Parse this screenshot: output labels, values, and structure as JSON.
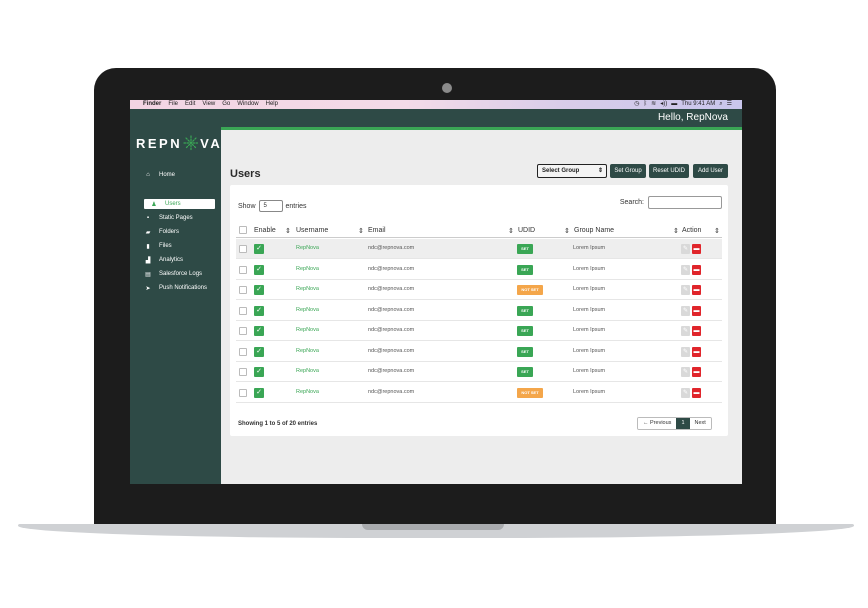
{
  "menubar": {
    "apple": "",
    "items": [
      "Finder",
      "File",
      "Edit",
      "View",
      "Go",
      "Window",
      "Help"
    ],
    "clock": "Thu 9:41 AM",
    "status_icons": [
      "clock-icon",
      "bluetooth-icon",
      "wifi-icon",
      "volume-icon",
      "battery-icon",
      "search-icon",
      "menu-icon"
    ]
  },
  "header": {
    "greeting": "Hello, RepNova"
  },
  "brand": {
    "logo_left": "REPN",
    "logo_right": "VA"
  },
  "sidebar": {
    "items": [
      {
        "label": "Home",
        "icon": "home-icon",
        "active": false
      },
      {
        "label": "Users",
        "icon": "user-icon",
        "active": true
      },
      {
        "label": "Static Pages",
        "icon": "page-icon",
        "active": false
      },
      {
        "label": "Folders",
        "icon": "folder-icon",
        "active": false
      },
      {
        "label": "Files",
        "icon": "file-icon",
        "active": false
      },
      {
        "label": "Analytics",
        "icon": "chart-icon",
        "active": false
      },
      {
        "label": "Salesforce Logs",
        "icon": "log-icon",
        "active": false
      },
      {
        "label": "Push Notifications",
        "icon": "send-icon",
        "active": false
      }
    ]
  },
  "page": {
    "title": "Users",
    "select_group": "Select Group",
    "buttons": {
      "set_group": "Set Group",
      "reset_udid": "Reset UDID",
      "add_user": "Add User"
    }
  },
  "table": {
    "show_label": "Show",
    "show_value": "5",
    "entries_label": "entries",
    "search_label": "Search:",
    "columns": [
      "Enable",
      "Username",
      "Email",
      "UDID",
      "Group Name",
      "Action"
    ],
    "rows": [
      {
        "username": "RepNova",
        "email": "ndc@repnova.com",
        "udid": "SET",
        "group": "Lorem Ipsum"
      },
      {
        "username": "RepNova",
        "email": "ndc@repnova.com",
        "udid": "SET",
        "group": "Lorem Ipsum"
      },
      {
        "username": "RepNova",
        "email": "ndc@repnova.com",
        "udid": "NOT SET",
        "group": "Lorem Ipsum"
      },
      {
        "username": "RepNova",
        "email": "ndc@repnova.com",
        "udid": "SET",
        "group": "Lorem Ipsum"
      },
      {
        "username": "RepNova",
        "email": "ndc@repnova.com",
        "udid": "SET",
        "group": "Lorem Ipsum"
      },
      {
        "username": "RepNova",
        "email": "ndc@repnova.com",
        "udid": "SET",
        "group": "Lorem Ipsum"
      },
      {
        "username": "RepNova",
        "email": "ndc@repnova.com",
        "udid": "SET",
        "group": "Lorem Ipsum"
      },
      {
        "username": "RepNova",
        "email": "ndc@repnova.com",
        "udid": "NOT SET",
        "group": "Lorem Ipsum"
      }
    ],
    "info": "Showing 1 to 5 of 20 entries",
    "pager": {
      "previous": "← Previous",
      "current": "1",
      "next": "Next"
    }
  },
  "colors": {
    "sidebar": "#2e4a46",
    "accent_green": "#3aa655",
    "warning_orange": "#f4a64a",
    "danger_red": "#e0252b"
  }
}
